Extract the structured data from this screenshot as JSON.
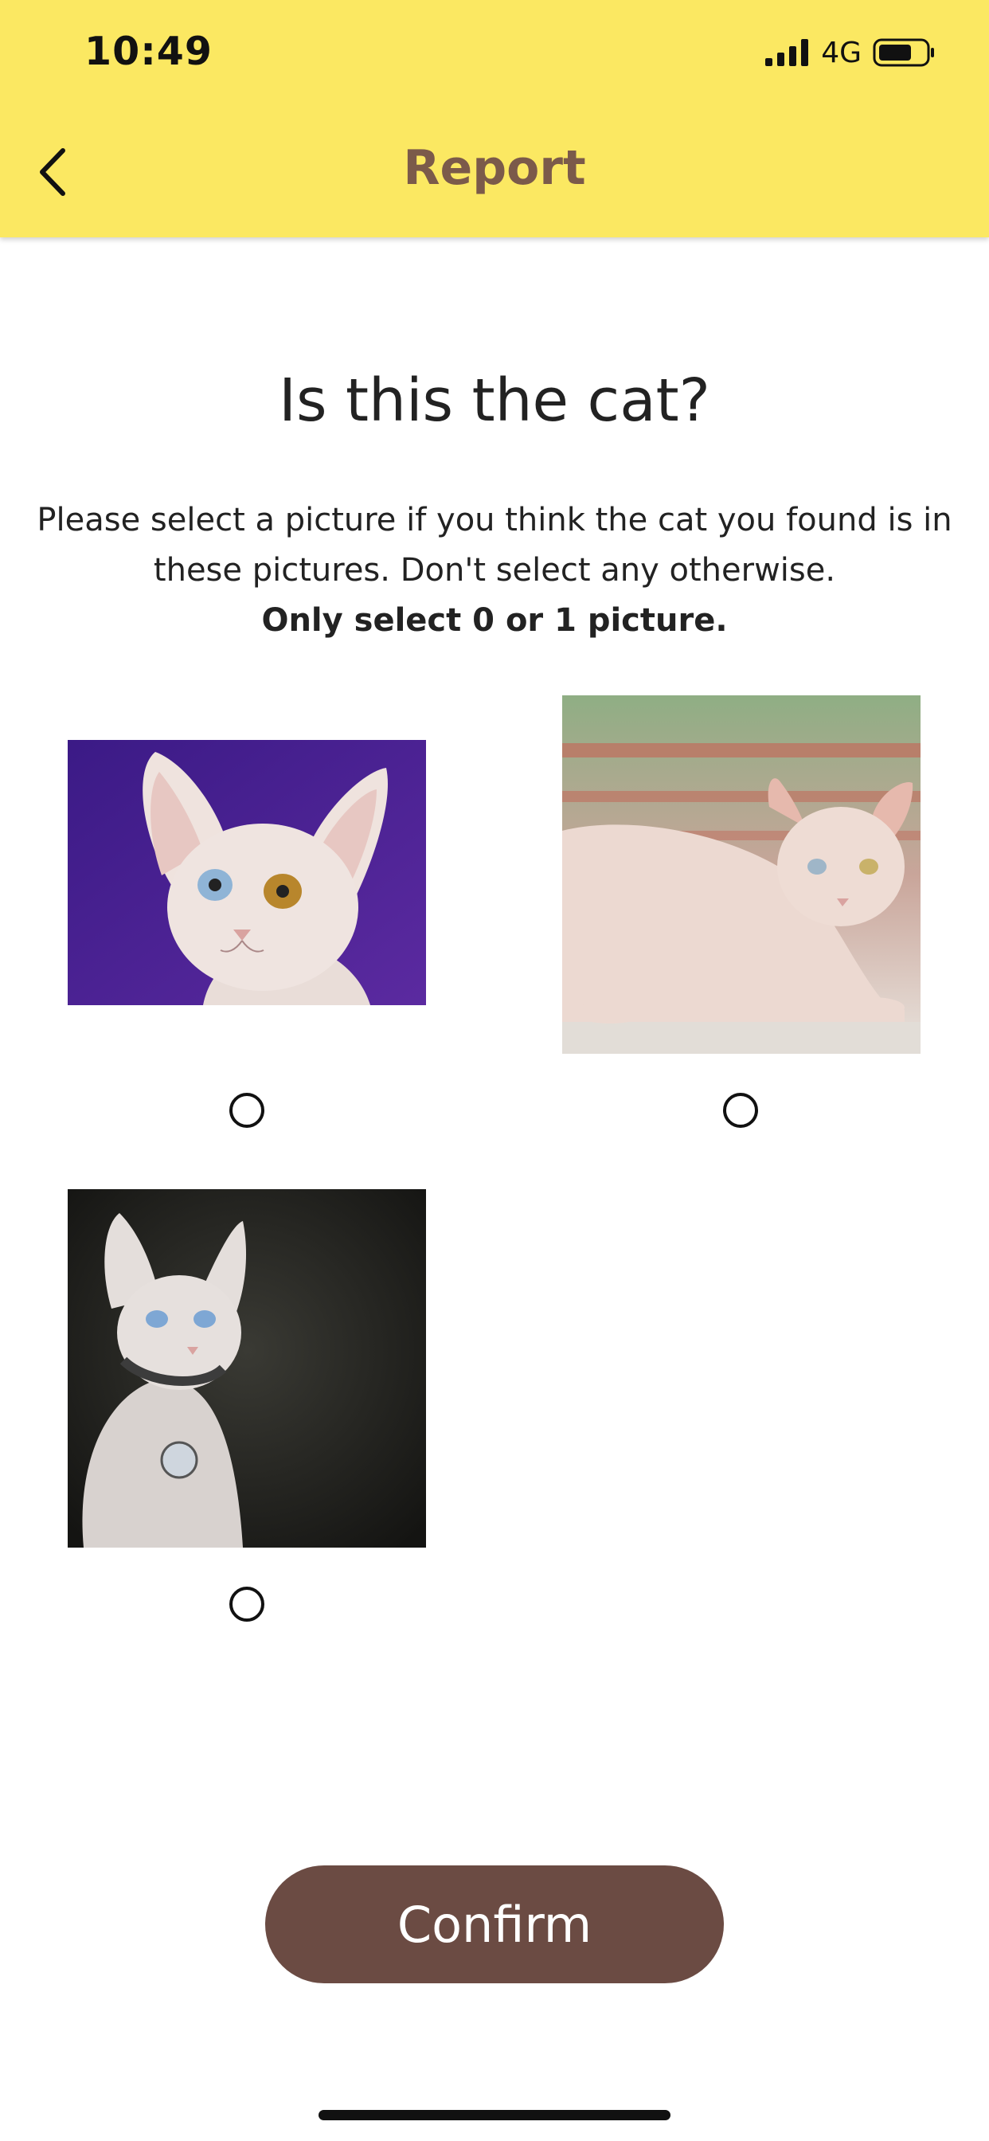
{
  "status_bar": {
    "time": "10:49",
    "network": "4G",
    "signal_icon": "cellular-signal-icon",
    "battery_icon": "battery-icon"
  },
  "header": {
    "title": "Report",
    "back_icon": "chevron-left-icon",
    "background_color": "#fbe862",
    "title_color": "#7b5a4a"
  },
  "main": {
    "question": "Is this the cat?",
    "instruction_line": "Please select a picture if you think the cat you found is in these pictures. Don't select any otherwise.",
    "instruction_emphasis": "Only select 0 or 1 picture.",
    "candidates": [
      {
        "description": "hairless-cat-purple-background",
        "selected": false
      },
      {
        "description": "hairless-cat-lying-by-window",
        "selected": false
      },
      {
        "description": "hairless-cat-collar-dark-background",
        "selected": false
      }
    ]
  },
  "confirm_button": {
    "label": "Confirm",
    "color": "#6b4b43"
  }
}
